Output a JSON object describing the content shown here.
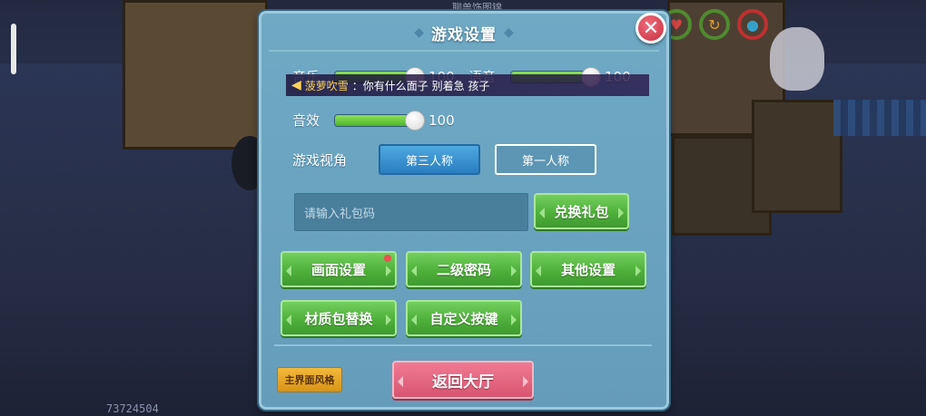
{
  "background": {
    "top_text": "聊兽饰图锦",
    "user_id": "73724504",
    "hud": {
      "icons": [
        "heart-icon",
        "refresh-icon",
        "drop-icon"
      ]
    }
  },
  "panel": {
    "title": "游戏设置",
    "close_symbol": "✕",
    "sliders": {
      "music": {
        "label": "音乐",
        "value": "100",
        "level": 1.0
      },
      "voice": {
        "label": "语音",
        "value": "100",
        "level": 1.0
      },
      "sfx": {
        "label": "音效",
        "value": "100",
        "level": 1.0
      }
    },
    "chat_banner": {
      "name": "菠萝吹雪",
      "message": "：你有什么面子 别着急 孩子"
    },
    "view": {
      "label": "游戏视角",
      "options": [
        "第三人称",
        "第一人称"
      ],
      "selected": "第三人称"
    },
    "gift": {
      "placeholder": "请输入礼包码",
      "redeem_label": "兑换礼包"
    },
    "buttons": {
      "graphics": "画面设置",
      "secondary_password": "二级密码",
      "other_settings": "其他设置",
      "texture_pack": "材质包替换",
      "custom_keys": "自定义按键"
    },
    "footer": {
      "ui_style": "主界面风格",
      "back_lobby": "返回大厅"
    }
  },
  "colors": {
    "panel_bg": "#6aa3c0",
    "green_button": "#4fb03b",
    "pink_button": "#d85570",
    "orange_button": "#e0a025",
    "active_tab": "#2a7ec0"
  }
}
